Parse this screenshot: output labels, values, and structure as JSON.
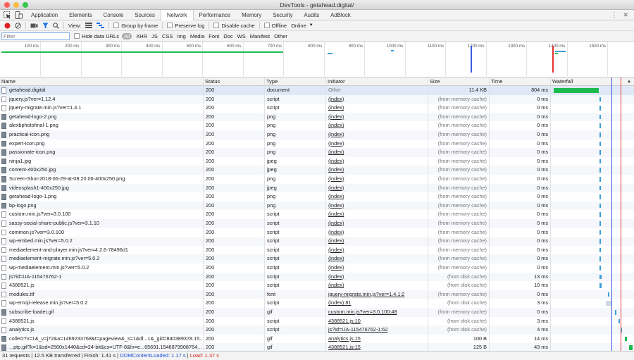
{
  "window": {
    "title": "DevTools - getahead.digital/"
  },
  "tabs": [
    {
      "label": "Application"
    },
    {
      "label": "Elements"
    },
    {
      "label": "Console"
    },
    {
      "label": "Sources"
    },
    {
      "label": "Network"
    },
    {
      "label": "Performance"
    },
    {
      "label": "Memory"
    },
    {
      "label": "Security"
    },
    {
      "label": "Audits"
    },
    {
      "label": "AdBlock"
    }
  ],
  "toolbar": {
    "view_label": "View:",
    "group_by_frame": "Group by frame",
    "preserve_log": "Preserve log",
    "disable_cache": "Disable cache",
    "offline": "Offline",
    "throttle": "Online"
  },
  "filterbar": {
    "placeholder": "Filter",
    "hide_data_urls": "Hide data URLs",
    "types": [
      "All",
      "XHR",
      "JS",
      "CSS",
      "Img",
      "Media",
      "Font",
      "Doc",
      "WS",
      "Manifest",
      "Other"
    ]
  },
  "overview": {
    "ticks": [
      "100 ms",
      "200 ms",
      "300 ms",
      "400 ms",
      "500 ms",
      "600 ms",
      "700 ms",
      "800 ms",
      "900 ms",
      "1000 ms",
      "1100 ms",
      "1200 ms",
      "1300 ms",
      "1400 ms",
      "1500 ms"
    ]
  },
  "columns": [
    "Name",
    "Status",
    "Type",
    "Initiator",
    "Size",
    "Time",
    "Waterfall"
  ],
  "rows": [
    {
      "name": "getahead.digital",
      "status": "200",
      "type": "document",
      "initiator": "Other",
      "size": "11.4 KB",
      "time": "804 ms"
    },
    {
      "name": "jquery.js?ver=1.12.4",
      "status": "200",
      "type": "script",
      "initiator": "(index)",
      "size": "(from memory cache)",
      "time": "0 ms"
    },
    {
      "name": "jquery-migrate.min.js?ver=1.4.1",
      "status": "200",
      "type": "script",
      "initiator": "(index)",
      "size": "(from memory cache)",
      "time": "0 ms"
    },
    {
      "name": "getahead-logo-2.png",
      "status": "200",
      "type": "png",
      "initiator": "(index)",
      "size": "(from memory cache)",
      "time": "0 ms"
    },
    {
      "name": "alexbphotofinal-1.png",
      "status": "200",
      "type": "png",
      "initiator": "(index)",
      "size": "(from memory cache)",
      "time": "0 ms"
    },
    {
      "name": "practical-icon.png",
      "status": "200",
      "type": "png",
      "initiator": "(index)",
      "size": "(from memory cache)",
      "time": "0 ms"
    },
    {
      "name": "expert-icon.png",
      "status": "200",
      "type": "png",
      "initiator": "(index)",
      "size": "(from memory cache)",
      "time": "0 ms"
    },
    {
      "name": "passionate-icon.png",
      "status": "200",
      "type": "png",
      "initiator": "(index)",
      "size": "(from memory cache)",
      "time": "0 ms"
    },
    {
      "name": "ninja1.jpg",
      "status": "200",
      "type": "jpeg",
      "initiator": "(index)",
      "size": "(from memory cache)",
      "time": "0 ms"
    },
    {
      "name": "content-400x250.jpg",
      "status": "200",
      "type": "jpeg",
      "initiator": "(index)",
      "size": "(from memory cache)",
      "time": "0 ms"
    },
    {
      "name": "Screen-Shot-2018-06-29-at-08.20.06-400x250.png",
      "status": "200",
      "type": "png",
      "initiator": "(index)",
      "size": "(from memory cache)",
      "time": "0 ms"
    },
    {
      "name": "videosplash1-400x250.jpg",
      "status": "200",
      "type": "jpeg",
      "initiator": "(index)",
      "size": "(from memory cache)",
      "time": "0 ms"
    },
    {
      "name": "getahead-logo-1.png",
      "status": "200",
      "type": "png",
      "initiator": "(index)",
      "size": "(from memory cache)",
      "time": "0 ms"
    },
    {
      "name": "bp-logo.png",
      "status": "200",
      "type": "png",
      "initiator": "(index)",
      "size": "(from memory cache)",
      "time": "0 ms"
    },
    {
      "name": "custom.min.js?ver=3.0.100",
      "status": "200",
      "type": "script",
      "initiator": "(index)",
      "size": "(from memory cache)",
      "time": "0 ms"
    },
    {
      "name": "sassy-social-share-public.js?ver=3.1.10",
      "status": "200",
      "type": "script",
      "initiator": "(index)",
      "size": "(from memory cache)",
      "time": "0 ms"
    },
    {
      "name": "common.js?ver=3.0.100",
      "status": "200",
      "type": "script",
      "initiator": "(index)",
      "size": "(from memory cache)",
      "time": "0 ms"
    },
    {
      "name": "wp-embed.min.js?ver=5.0.2",
      "status": "200",
      "type": "script",
      "initiator": "(index)",
      "size": "(from memory cache)",
      "time": "0 ms"
    },
    {
      "name": "mediaelement-and-player.min.js?ver=4.2.6-78496d1",
      "status": "200",
      "type": "script",
      "initiator": "(index)",
      "size": "(from memory cache)",
      "time": "0 ms"
    },
    {
      "name": "mediaelement-migrate.min.js?ver=5.0.2",
      "status": "200",
      "type": "script",
      "initiator": "(index)",
      "size": "(from memory cache)",
      "time": "0 ms"
    },
    {
      "name": "wp-mediaelement.min.js?ver=5.0.2",
      "status": "200",
      "type": "script",
      "initiator": "(index)",
      "size": "(from memory cache)",
      "time": "0 ms"
    },
    {
      "name": "js?id=UA-115476762-1",
      "status": "200",
      "type": "script",
      "initiator": "(index)",
      "size": "(from disk cache)",
      "time": "13 ms"
    },
    {
      "name": "4388521.js",
      "status": "200",
      "type": "script",
      "initiator": "(index)",
      "size": "(from disk cache)",
      "time": "10 ms"
    },
    {
      "name": "modules.ttf",
      "status": "200",
      "type": "font",
      "initiator": "jquery-migrate.min.js?ver=1.4.1:2",
      "size": "(from memory cache)",
      "time": "0 ms"
    },
    {
      "name": "wp-emoji-release.min.js?ver=5.0.2",
      "status": "200",
      "type": "script",
      "initiator": "(index):81",
      "size": "(from disk cache)",
      "time": "3 ms"
    },
    {
      "name": "subscribe-loader.gif",
      "status": "200",
      "type": "gif",
      "initiator": "custom.min.js?ver=3.0.100:48",
      "size": "(from memory cache)",
      "time": "0 ms"
    },
    {
      "name": "4388521.js",
      "status": "200",
      "type": "script",
      "initiator": "4388521.js:10",
      "size": "(from disk cache)",
      "time": "3 ms"
    },
    {
      "name": "analytics.js",
      "status": "200",
      "type": "script",
      "initiator": "js?id=UA-115476762-1:62",
      "size": "(from disk cache)",
      "time": "4 ms"
    },
    {
      "name": "collect?v=1&_v=j72&a=1469233768&t=pageview&_s=1&dl...1&_gid=840389378.15...",
      "status": "200",
      "type": "gif",
      "initiator": "analytics.js:15",
      "size": "100 B",
      "time": "14 ms"
    },
    {
      "name": "...ptp.gif?k=1&sd=2560x1440&cd=24-bit&cs=UTF-8&ln=e...65691.1546879908764...",
      "status": "200",
      "type": "gif",
      "initiator": "4388521.js:15",
      "size": "125 B",
      "time": "43 ms"
    }
  ],
  "statusbar": {
    "summary": "31 requests | 12.5 KB transferred | Finish: 1.41 s | ",
    "dom_content_loaded": "DOMContentLoaded: 1.17 s",
    "separator": " | ",
    "load": "Load: 1.37 s"
  },
  "colors": {
    "dom_line": "#3b5bdb",
    "load_line": "#e03131",
    "doc_bar": "#1dbb4e",
    "script_bar": "#3b9ed8"
  }
}
